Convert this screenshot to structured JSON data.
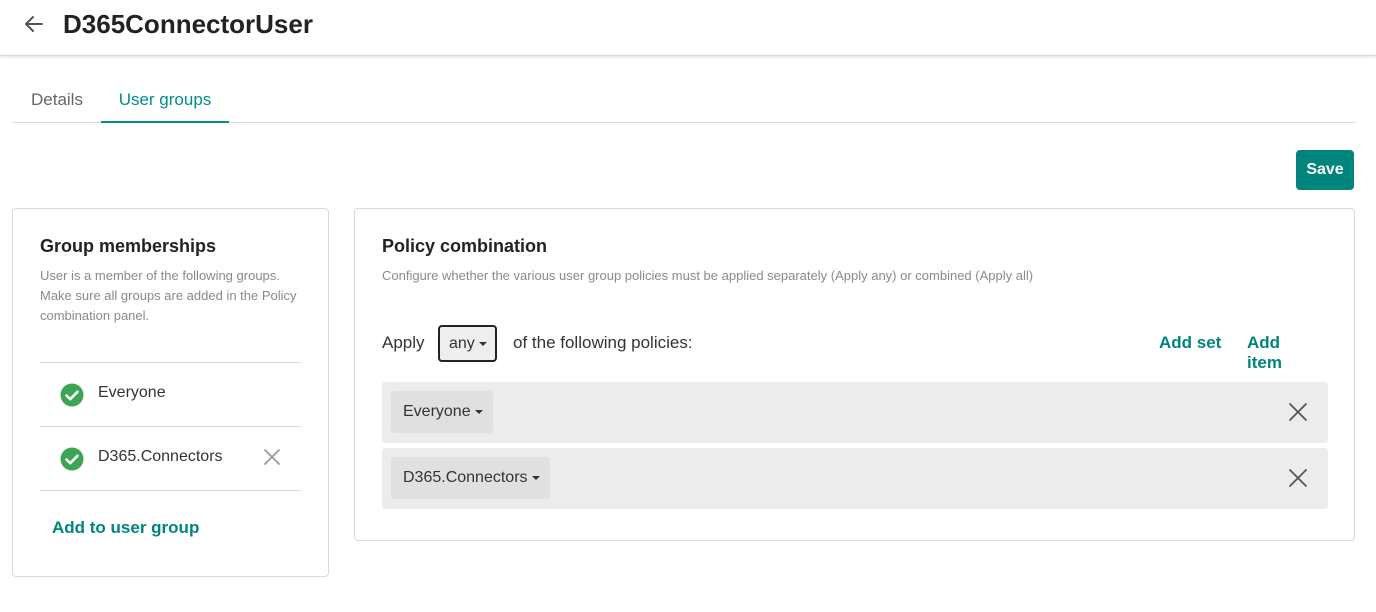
{
  "header": {
    "title": "D365ConnectorUser",
    "back_icon": "arrow-left-icon"
  },
  "tabs": [
    {
      "label": "Details",
      "active": false
    },
    {
      "label": "User groups",
      "active": true
    }
  ],
  "toolbar": {
    "save_label": "Save"
  },
  "group_memberships": {
    "title": "Group memberships",
    "description": "User is a member of the following groups. Make sure all groups are added in the Policy combination panel.",
    "items": [
      {
        "label": "Everyone",
        "removable": false
      },
      {
        "label": "D365.Connectors",
        "removable": true
      }
    ],
    "add_link": "Add to user group"
  },
  "policy_combination": {
    "title": "Policy combination",
    "description": "Configure whether the various user group policies must be applied separately (Apply any) or combined (Apply all)",
    "apply_label": "Apply",
    "mode_value": "any",
    "following_label": "of the following policies:",
    "add_set": "Add set",
    "add_item": "Add item",
    "policies": [
      {
        "label": "Everyone"
      },
      {
        "label": "D365.Connectors"
      }
    ]
  },
  "colors": {
    "accent": "#00857d",
    "check": "#3ca556",
    "row_bg": "#ececec"
  }
}
